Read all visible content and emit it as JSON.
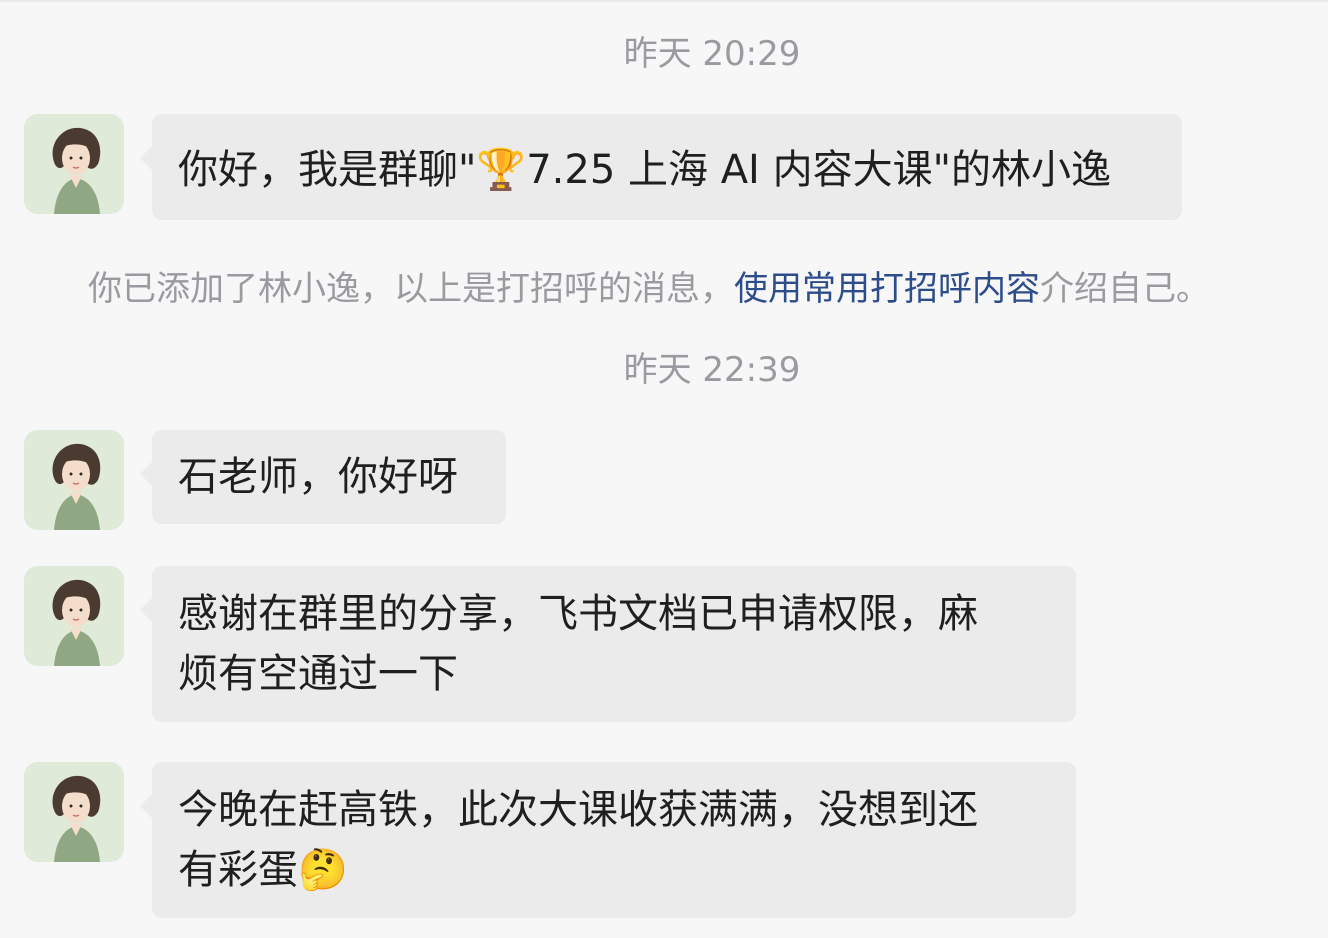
{
  "timestamps": {
    "first": "昨天 20:29",
    "second": "昨天 22:39"
  },
  "messages": [
    {
      "text": "你好，我是群聊\"🏆7.25 上海 AI 内容大课\"的林小逸"
    },
    {
      "text": "石老师，你好呀"
    },
    {
      "text": "感谢在群里的分享，飞书文档已申请权限，麻\n烦有空通过一下"
    },
    {
      "text": "今晚在赶高铁，此次大课收获满满，没想到还\n有彩蛋🤔"
    }
  ],
  "system_note": {
    "prefix": "你已添加了林小逸，以上是打招呼的消息，",
    "link": "使用常用打招呼内容",
    "suffix": "介绍自己。"
  },
  "icons": {
    "avatar": "woman-avatar-icon"
  },
  "colors": {
    "background": "#f7f7f7",
    "bubble": "#ebebeb",
    "link": "#2d4d8a",
    "muted_text": "#9a9aa0"
  }
}
